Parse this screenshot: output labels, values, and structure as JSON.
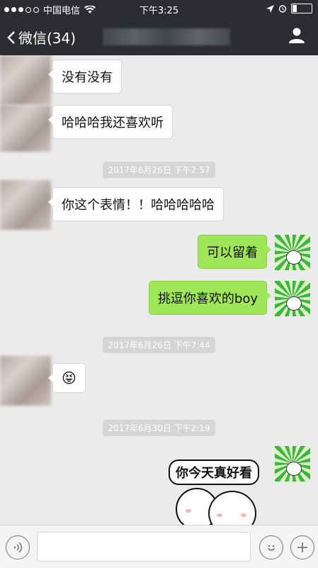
{
  "status_bar": {
    "carrier": "中国电信",
    "time": "下午3:25"
  },
  "nav": {
    "back_label": "微信(34)"
  },
  "messages": {
    "m1": "没有没有",
    "m2": "哈哈哈我还喜欢听",
    "ts1": "2017年6月26日 下午2:57",
    "m3": "你这个表情！！哈哈哈哈哈",
    "m4": "可以留着",
    "m5": "挑逗你喜欢的boy",
    "ts2": "2017年6月26日 下午7:44",
    "m6_emoji": "😝",
    "ts3": "2017年6月30日 下午2:19",
    "sticker_text": "你今天真好看"
  },
  "icons": [
    "back-chevron-icon",
    "profile-icon",
    "wifi-icon",
    "location-icon",
    "alarm-icon",
    "battery-icon",
    "voice-icon",
    "emoji-icon",
    "plus-icon"
  ]
}
